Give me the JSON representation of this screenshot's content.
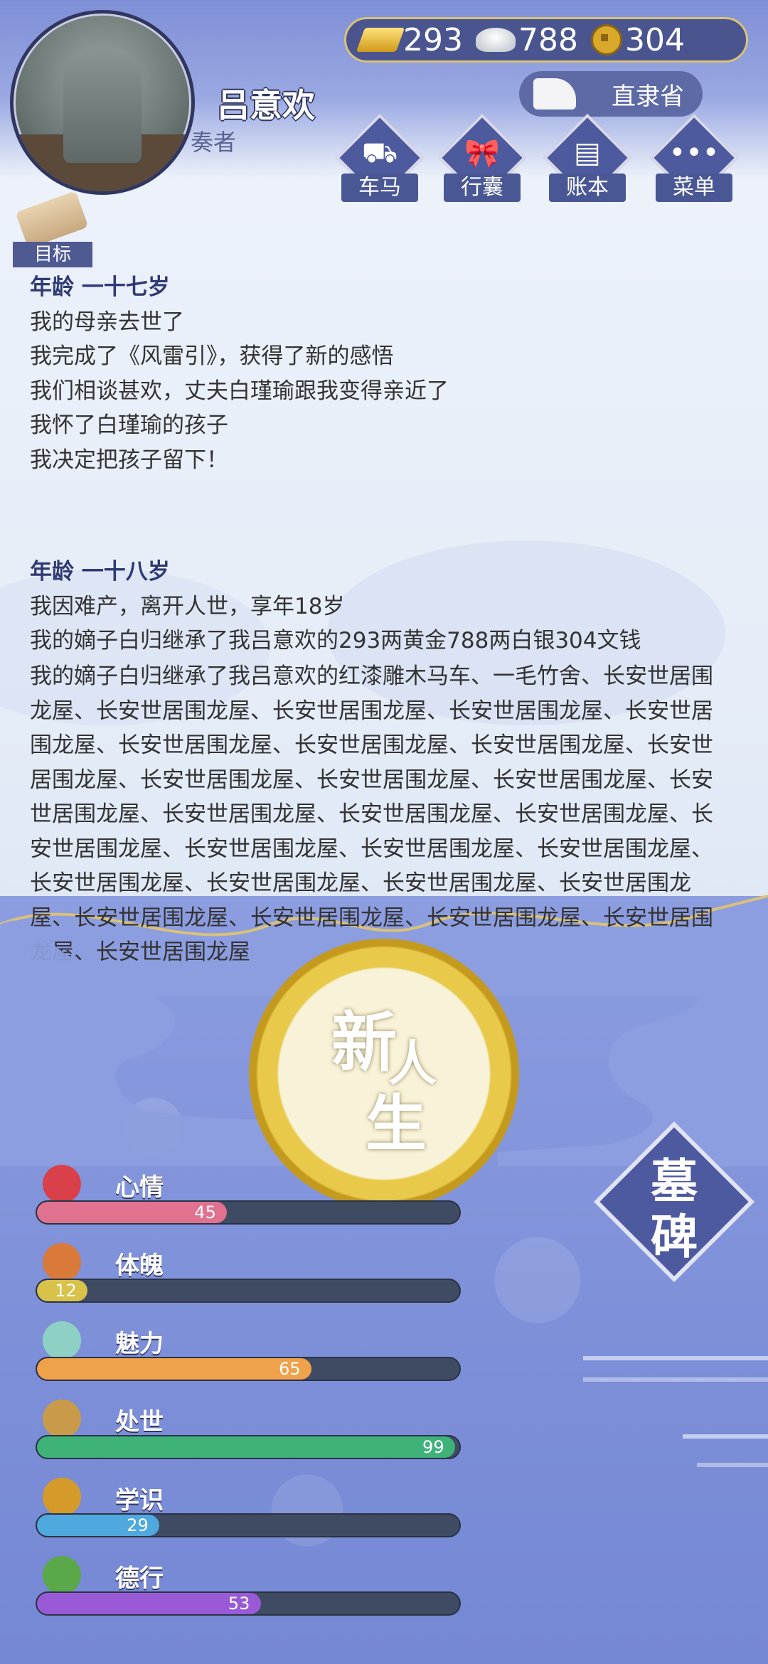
{
  "player": {
    "name": "吕意欢",
    "title": "奏者"
  },
  "currency": {
    "gold": "293",
    "silver": "788",
    "coins": "304"
  },
  "region": "直隶省",
  "menu": [
    {
      "label": "车马",
      "icon": "carriage-icon"
    },
    {
      "label": "行囊",
      "icon": "bag-icon"
    },
    {
      "label": "账本",
      "icon": "ledger-icon"
    },
    {
      "label": "菜单",
      "icon": "more-icon"
    }
  ],
  "goal_label": "目标",
  "log": {
    "age17": {
      "heading": "年龄 一十七岁",
      "lines": [
        "我的母亲去世了",
        "我完成了《风雷引》，获得了新的感悟",
        "我们相谈甚欢，丈夫白瑾瑜跟我变得亲近了",
        "我怀了白瑾瑜的孩子",
        "我决定把孩子留下！"
      ]
    },
    "age18": {
      "heading": "年龄 一十八岁",
      "lines": [
        "我因难产，离开人世，享年18岁",
        "我的嫡子白归继承了我吕意欢的293两黄金788两白银304文钱"
      ],
      "inherit": "我的嫡子白归继承了我吕意欢的红漆雕木马车、一毛竹舍、长安世居围龙屋、长安世居围龙屋、长安世居围龙屋、长安世居围龙屋、长安世居围龙屋、长安世居围龙屋、长安世居围龙屋、长安世居围龙屋、长安世居围龙屋、长安世居围龙屋、长安世居围龙屋、长安世居围龙屋、长安世居围龙屋、长安世居围龙屋、长安世居围龙屋、长安世居围龙屋、长安世居围龙屋、长安世居围龙屋、长安世居围龙屋、长安世居围龙屋、长安世居围龙屋、长安世居围龙屋、长安世居围龙屋、长安世居围龙屋、长安世居围龙屋、长安世居围龙屋、长安世居围龙屋、长安世居围龙屋、长安世居围龙屋"
    }
  },
  "new_life": {
    "c1": "新",
    "c2": "人",
    "c3": "生"
  },
  "tomb": {
    "c1": "墓",
    "c2": "碑"
  },
  "stats": [
    {
      "name": "心情",
      "value": "45",
      "pct": 45,
      "color": "#e0718f",
      "icon": "flower-icon",
      "icon_color": "#d9404a"
    },
    {
      "name": "体魄",
      "value": "12",
      "pct": 12,
      "color": "#d8c24a",
      "icon": "fire-hydrant-icon",
      "icon_color": "#d9793a"
    },
    {
      "name": "魅力",
      "value": "65",
      "pct": 65,
      "color": "#efa24a",
      "icon": "mirror-icon",
      "icon_color": "#8fd0c5"
    },
    {
      "name": "处世",
      "value": "99",
      "pct": 99,
      "color": "#3fb27a",
      "icon": "hand-fan-icon",
      "icon_color": "#c89a4a"
    },
    {
      "name": "学识",
      "value": "29",
      "pct": 29,
      "color": "#4fa8de",
      "icon": "brush-pot-icon",
      "icon_color": "#d49a2a"
    },
    {
      "name": "德行",
      "value": "53",
      "pct": 53,
      "color": "#9a5ad8",
      "icon": "pipa-icon",
      "icon_color": "#5aa84a"
    }
  ]
}
